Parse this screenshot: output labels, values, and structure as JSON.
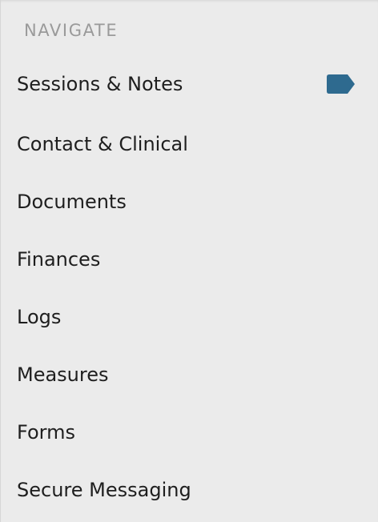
{
  "nav": {
    "heading": "NAVIGATE",
    "items": [
      {
        "label": "Sessions & Notes",
        "icon": "tag-icon",
        "icon_color": "#2e6a8f"
      },
      {
        "label": "Contact & Clinical"
      },
      {
        "label": "Documents"
      },
      {
        "label": "Finances"
      },
      {
        "label": "Logs"
      },
      {
        "label": "Measures"
      },
      {
        "label": "Forms"
      },
      {
        "label": "Secure Messaging"
      }
    ]
  },
  "colors": {
    "background": "#ebebeb",
    "heading": "#9a9a9a",
    "text": "#1e1e1e",
    "accent": "#2e6a8f"
  }
}
